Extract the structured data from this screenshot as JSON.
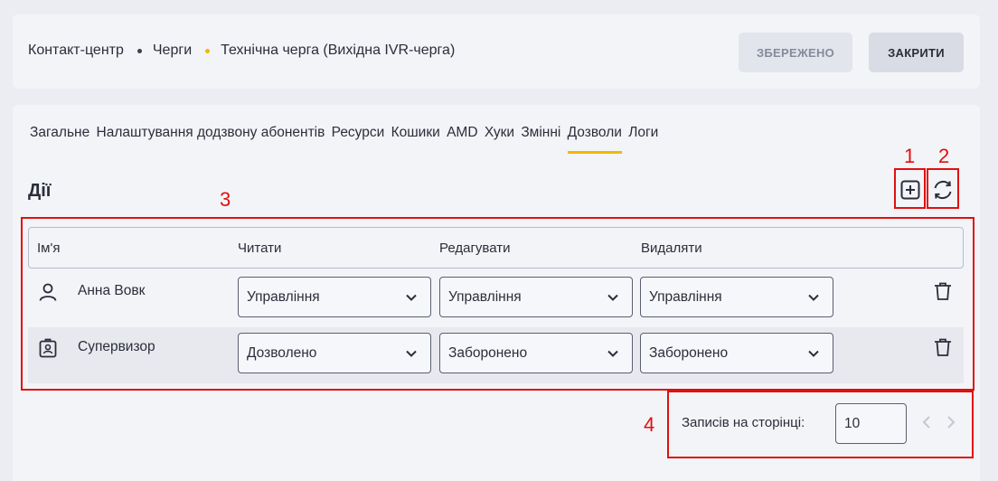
{
  "breadcrumbs": [
    "Контакт-центр",
    "Черги",
    "Технічна черга (Вихідна IVR-черга)"
  ],
  "header_buttons": {
    "saved": "ЗБЕРЕЖЕНО",
    "close": "ЗАКРИТИ"
  },
  "tabs": [
    {
      "label": "Загальне",
      "active": false
    },
    {
      "label": "Налаштування додзвону абонентів",
      "active": false
    },
    {
      "label": "Ресурси",
      "active": false
    },
    {
      "label": "Кошики",
      "active": false
    },
    {
      "label": "AMD",
      "active": false
    },
    {
      "label": "Хуки",
      "active": false
    },
    {
      "label": "Змінні",
      "active": false
    },
    {
      "label": "Дозволи",
      "active": true
    },
    {
      "label": "Логи",
      "active": false
    }
  ],
  "section_title": "Дії",
  "table": {
    "headers": [
      "Ім'я",
      "Читати",
      "Редагувати",
      "Видаляти"
    ],
    "rows": [
      {
        "icon": "user-icon",
        "name": "Анна Вовк",
        "read": "Управління",
        "edit": "Управління",
        "delete": "Управління"
      },
      {
        "icon": "id-badge-icon",
        "name": "Супервизор",
        "read": "Дозволено",
        "edit": "Заборонено",
        "delete": "Заборонено"
      }
    ]
  },
  "pagination": {
    "label": "Записів на сторінці:",
    "per_page": "10"
  },
  "annotations": [
    "1",
    "2",
    "3",
    "4"
  ],
  "colors": {
    "accent": "#f2b705",
    "annotation": "#e01010"
  }
}
